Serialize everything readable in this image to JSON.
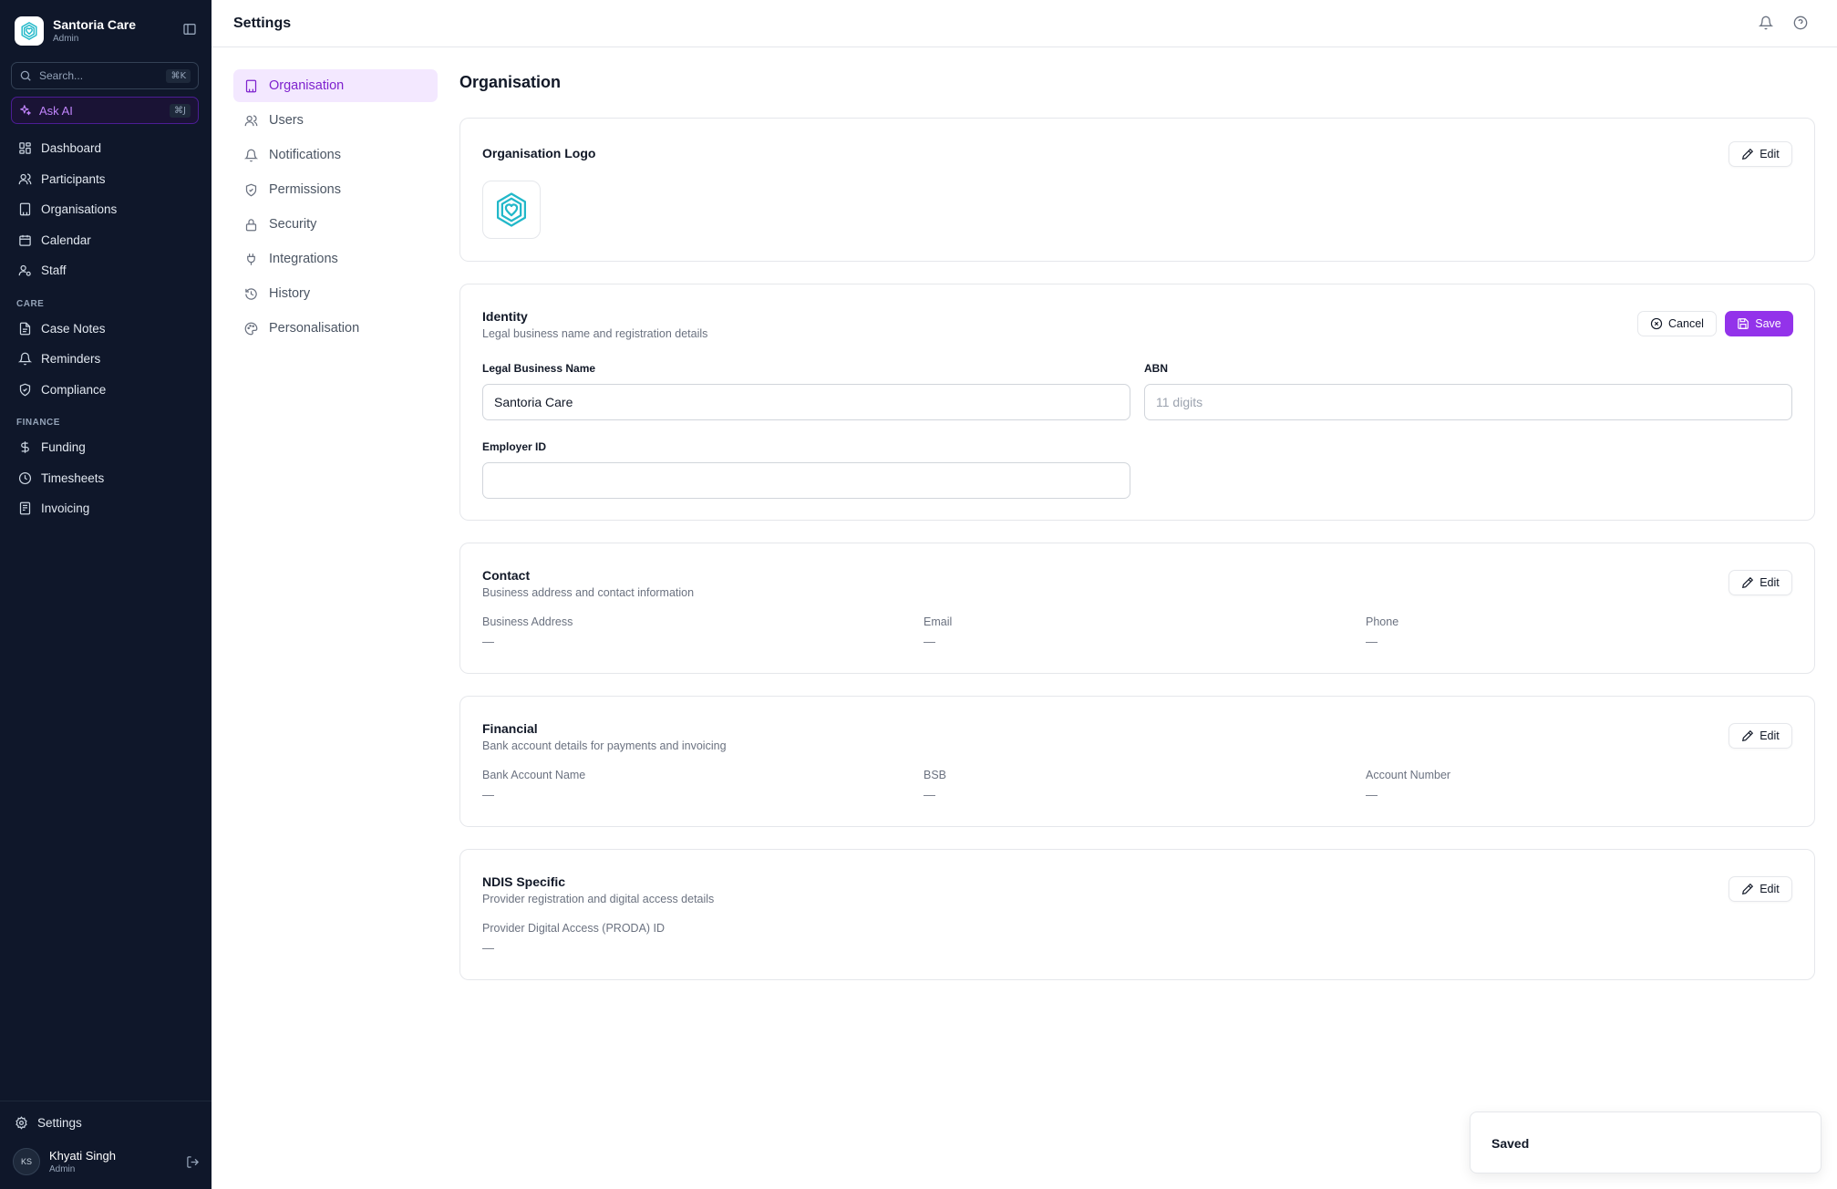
{
  "sidebar": {
    "org_name": "Santoria Care",
    "org_role": "Admin",
    "search_placeholder": "Search...",
    "search_shortcut": "⌘K",
    "ask_ai_label": "Ask AI",
    "ask_ai_shortcut": "⌘J",
    "main_items": [
      {
        "label": "Dashboard",
        "icon": "dashboard-icon"
      },
      {
        "label": "Participants",
        "icon": "users-icon"
      },
      {
        "label": "Organisations",
        "icon": "building-icon"
      },
      {
        "label": "Calendar",
        "icon": "calendar-icon"
      },
      {
        "label": "Staff",
        "icon": "staff-icon"
      }
    ],
    "care_section": "CARE",
    "care_items": [
      {
        "label": "Case Notes",
        "icon": "file-icon"
      },
      {
        "label": "Reminders",
        "icon": "bell-icon"
      },
      {
        "label": "Compliance",
        "icon": "shield-check-icon"
      }
    ],
    "finance_section": "FINANCE",
    "finance_items": [
      {
        "label": "Funding",
        "icon": "dollar-icon"
      },
      {
        "label": "Timesheets",
        "icon": "clock-icon"
      },
      {
        "label": "Invoicing",
        "icon": "receipt-icon"
      }
    ],
    "settings_label": "Settings",
    "user_initials": "KS",
    "user_name": "Khyati Singh",
    "user_role": "Admin"
  },
  "topbar": {
    "title": "Settings"
  },
  "settings_nav": [
    {
      "label": "Organisation",
      "icon": "building-icon",
      "active": true
    },
    {
      "label": "Users",
      "icon": "users-icon",
      "active": false
    },
    {
      "label": "Notifications",
      "icon": "bell-icon",
      "active": false
    },
    {
      "label": "Permissions",
      "icon": "shield-check-icon",
      "active": false
    },
    {
      "label": "Security",
      "icon": "lock-icon",
      "active": false
    },
    {
      "label": "Integrations",
      "icon": "plug-icon",
      "active": false
    },
    {
      "label": "History",
      "icon": "history-icon",
      "active": false
    },
    {
      "label": "Personalisation",
      "icon": "palette-icon",
      "active": false
    }
  ],
  "main": {
    "section_title": "Organisation",
    "logo_card": {
      "title": "Organisation Logo",
      "edit_label": "Edit"
    },
    "identity": {
      "title": "Identity",
      "subtitle": "Legal business name and registration details",
      "cancel_label": "Cancel",
      "save_label": "Save",
      "legal_name_label": "Legal Business Name",
      "legal_name_value": "Santoria Care",
      "abn_label": "ABN",
      "abn_placeholder": "11 digits",
      "employer_id_label": "Employer ID",
      "employer_id_value": ""
    },
    "contact": {
      "title": "Contact",
      "subtitle": "Business address and contact information",
      "edit_label": "Edit",
      "fields": [
        {
          "label": "Business Address",
          "value": "—"
        },
        {
          "label": "Email",
          "value": "—"
        },
        {
          "label": "Phone",
          "value": "—"
        }
      ]
    },
    "financial": {
      "title": "Financial",
      "subtitle": "Bank account details for payments and invoicing",
      "edit_label": "Edit",
      "fields": [
        {
          "label": "Bank Account Name",
          "value": "—"
        },
        {
          "label": "BSB",
          "value": "—"
        },
        {
          "label": "Account Number",
          "value": "—"
        }
      ]
    },
    "ndis": {
      "title": "NDIS Specific",
      "subtitle": "Provider registration and digital access details",
      "edit_label": "Edit",
      "fields": [
        {
          "label": "Provider Digital Access (PRODA) ID",
          "value": "—"
        }
      ]
    }
  },
  "toast": {
    "message": "Saved"
  },
  "colors": {
    "sidebar_bg": "#0f172a",
    "accent": "#9333ea",
    "accent_soft": "#f3e8ff",
    "logo_teal": "#22b8c9"
  }
}
